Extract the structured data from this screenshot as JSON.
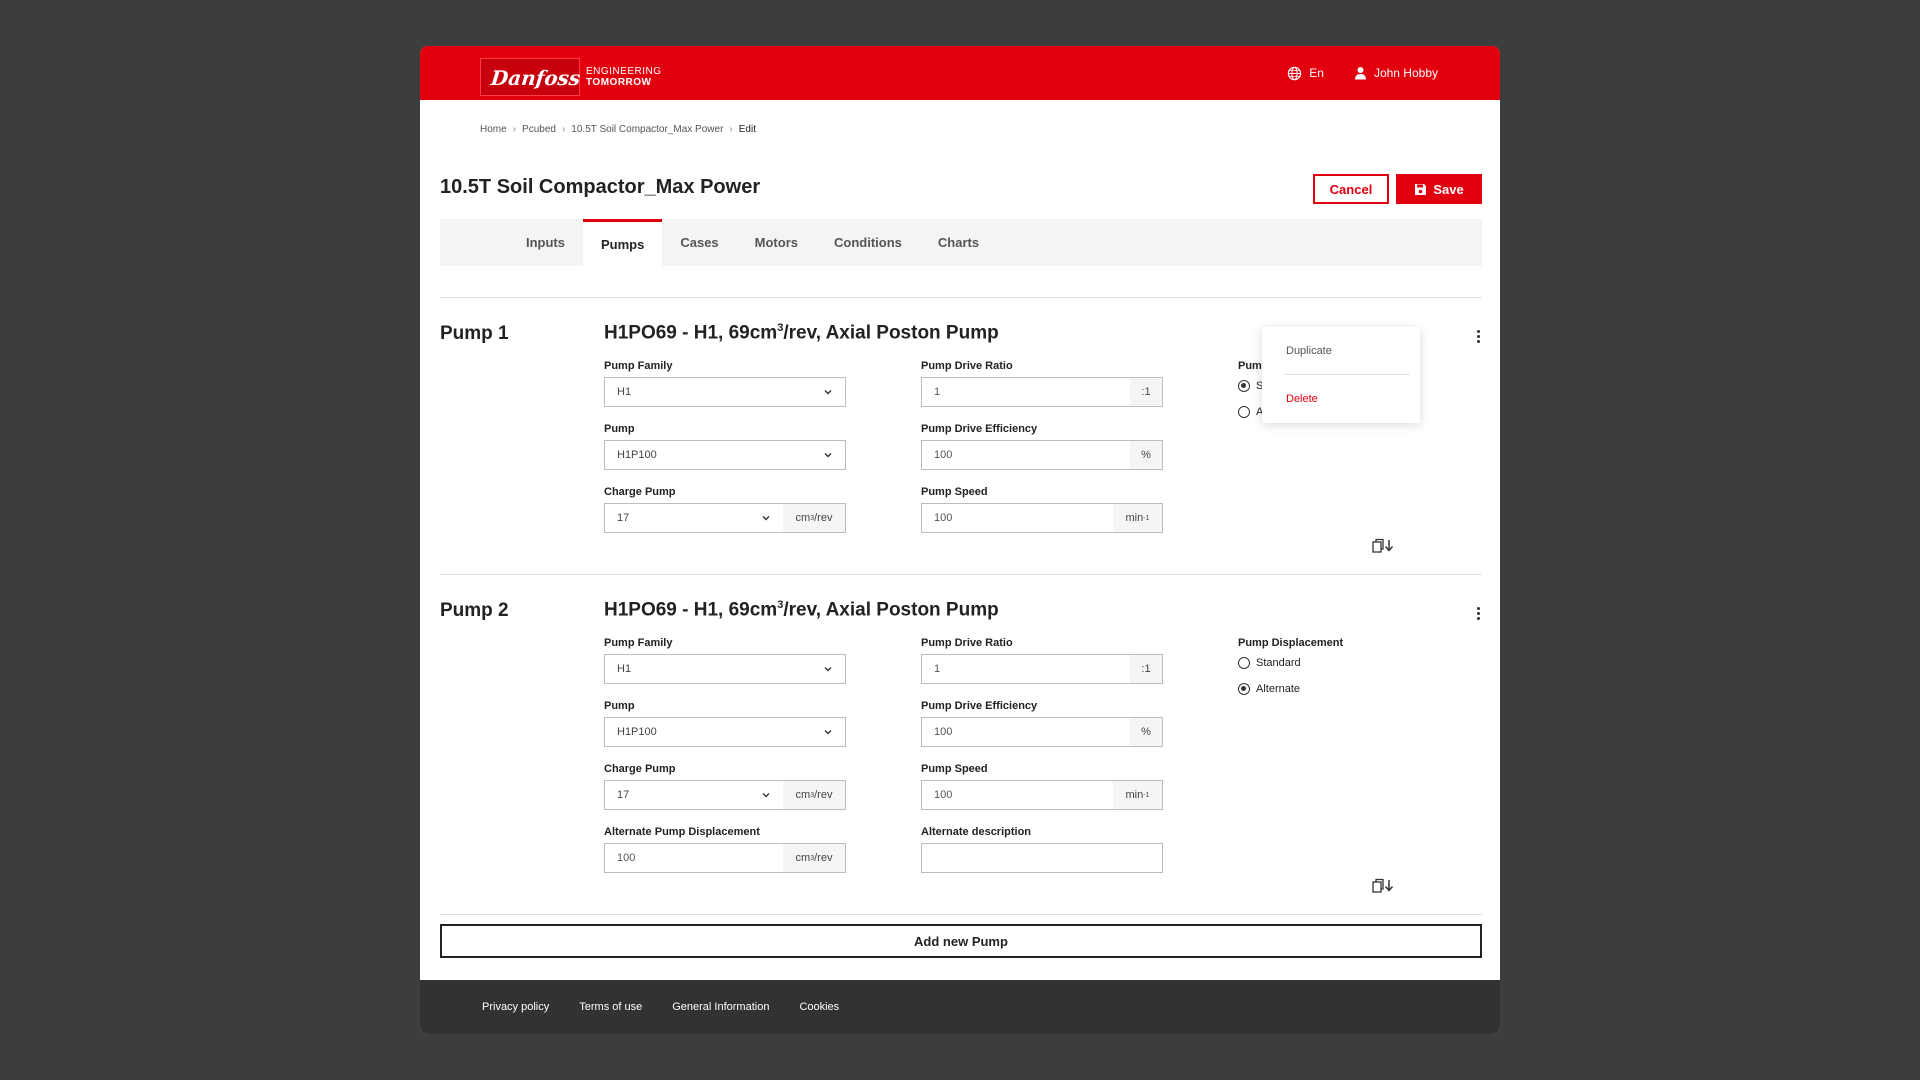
{
  "header": {
    "logo_text": "Danfoss",
    "tagline_line1": "ENGINEERING",
    "tagline_line2": "TOMORROW",
    "language": "En",
    "user_name": "John Hobby"
  },
  "breadcrumb": [
    "Home",
    "Pcubed",
    "10.5T Soil Compactor_Max Power",
    "Edit"
  ],
  "page": {
    "title": "10.5T Soil Compactor_Max Power",
    "cancel_label": "Cancel",
    "save_label": "Save"
  },
  "tabs": [
    "Inputs",
    "Pumps",
    "Cases",
    "Motors",
    "Conditions",
    "Charts"
  ],
  "active_tab": "Pumps",
  "pumps": [
    {
      "label": "Pump 1",
      "heading_prefix": "H1PO69 - H1, 69cm",
      "heading_sup": "3",
      "heading_suffix": "/rev, Axial Poston Pump",
      "pump_family_label": "Pump Family",
      "pump_family_value": "H1",
      "pump_label": "Pump",
      "pump_value": "H1P100",
      "charge_pump_label": "Charge Pump",
      "charge_pump_value": "17",
      "charge_pump_unit": "cm",
      "charge_pump_unit_sup": "3",
      "charge_pump_unit_suffix": "/rev",
      "drive_ratio_label": "Pump Drive Ratio",
      "drive_ratio_value": "1",
      "drive_ratio_unit": ":1",
      "drive_eff_label": "Pump Drive Efficiency",
      "drive_eff_value": "100",
      "drive_eff_unit": "%",
      "speed_label": "Pump Speed",
      "speed_value": "100",
      "speed_unit": "min",
      "speed_unit_sup": "-1",
      "displacement_label_partial": "Pum",
      "displacement_options_partial": [
        "S",
        "A"
      ],
      "displacement_selected": 0
    },
    {
      "label": "Pump 2",
      "heading_prefix": "H1PO69 - H1, 69cm",
      "heading_sup": "3",
      "heading_suffix": "/rev, Axial Poston Pump",
      "pump_family_label": "Pump Family",
      "pump_family_value": "H1",
      "pump_label": "Pump",
      "pump_value": "H1P100",
      "charge_pump_label": "Charge Pump",
      "charge_pump_value": "17",
      "charge_pump_unit": "cm",
      "charge_pump_unit_sup": "3",
      "charge_pump_unit_suffix": "/rev",
      "drive_ratio_label": "Pump Drive Ratio",
      "drive_ratio_value": "1",
      "drive_ratio_unit": ":1",
      "drive_eff_label": "Pump Drive Efficiency",
      "drive_eff_value": "100",
      "drive_eff_unit": "%",
      "speed_label": "Pump Speed",
      "speed_value": "100",
      "speed_unit": "min",
      "speed_unit_sup": "-1",
      "displacement_label": "Pump Displacement",
      "displacement_options": [
        "Standard",
        "Alternate"
      ],
      "displacement_selected": 1,
      "alt_disp_label": "Alternate Pump Displacement",
      "alt_disp_value": "100",
      "alt_disp_unit": "cm",
      "alt_disp_unit_sup": "3",
      "alt_disp_unit_suffix": "/rev",
      "alt_desc_label": "Alternate description",
      "alt_desc_value": ""
    }
  ],
  "context_menu": {
    "duplicate": "Duplicate",
    "delete": "Delete"
  },
  "add_pump_label": "Add new Pump",
  "footer": [
    "Privacy policy",
    "Terms of use",
    "General Information",
    "Cookies"
  ],
  "colors": {
    "brand_red": "#e2000f",
    "background": "#3d3d3d",
    "footer": "#323232"
  },
  "icons": [
    "globe-icon",
    "user-icon",
    "save-disk-icon",
    "chevron-down-icon",
    "kebab-icon",
    "copy-download-icon"
  ]
}
